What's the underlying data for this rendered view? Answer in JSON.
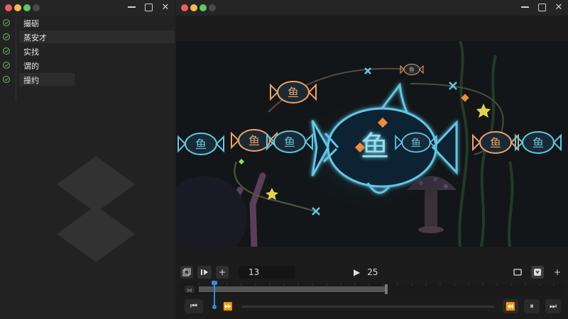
{
  "left_window": {
    "items": [
      {
        "label": "撮砺",
        "highlight": false
      },
      {
        "label": "蒸安才",
        "highlight": true
      },
      {
        "label": "实找",
        "highlight": false
      },
      {
        "label": "谓的",
        "highlight": false
      },
      {
        "label": "撞约",
        "highlight": true
      }
    ]
  },
  "scene": {
    "main_glyph": "鱼",
    "small_glyph": "鱼"
  },
  "controls": {
    "current_frame": "13",
    "end_frame": "25"
  },
  "colors": {
    "glow": "#5ec8e6",
    "accent_orange": "#f08a3c",
    "playhead": "#2f8fe0"
  }
}
